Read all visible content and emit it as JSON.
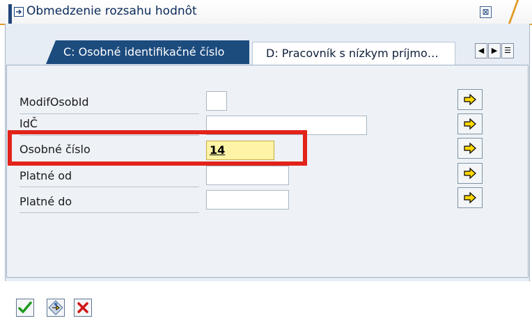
{
  "window": {
    "title": "Obmedzenie rozsahu hodnôt",
    "close_label": "⊠"
  },
  "tabs": [
    {
      "label": "C: Osobné identifikačné číslo",
      "active": true
    },
    {
      "label": "D: Pracovník s nízkym príjmo…",
      "active": false
    }
  ],
  "tab_nav": {
    "prev": "◀",
    "next": "▶",
    "menu": "☰"
  },
  "form": {
    "fields": [
      {
        "label": "ModifOsobId",
        "value": ""
      },
      {
        "label": "IdČ",
        "value": ""
      },
      {
        "label": "Osobné číslo",
        "value": "14"
      },
      {
        "label": "Platné od",
        "value": ""
      },
      {
        "label": "Platné do",
        "value": ""
      }
    ]
  },
  "colors": {
    "accent": "#e29b29",
    "active_tab": "#1c4b7e",
    "highlight": "#e2231a",
    "focus_field": "#fff3a6"
  },
  "toolbar": {
    "icons": [
      "check-icon",
      "multi-select-icon",
      "cancel-icon"
    ]
  }
}
